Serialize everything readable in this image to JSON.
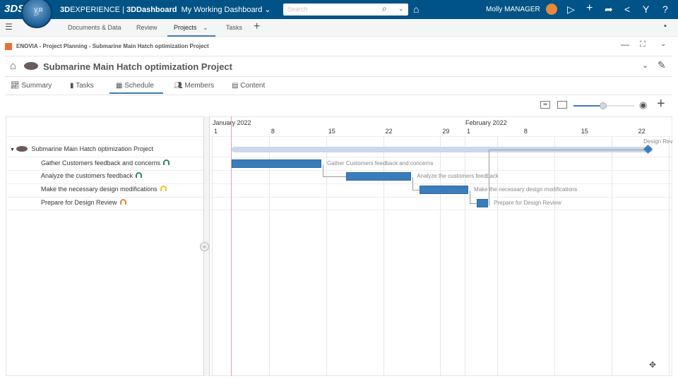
{
  "topbar": {
    "brand_bold": "3D",
    "brand_rest": "EXPERIENCE | ",
    "app": "3DDashboard",
    "dashboard": "My Working Dashboard",
    "search_placeholder": "Search",
    "user": "Molly MANAGER",
    "compass_labels": [
      "V,R",
      "3D"
    ],
    "icons": [
      "notifications-icon",
      "add-icon",
      "share-icon",
      "social-icon",
      "apps-icon",
      "help-icon"
    ]
  },
  "tabs": [
    {
      "label": "Documents & Data"
    },
    {
      "label": "Review"
    },
    {
      "label": "Projects",
      "active": true
    },
    {
      "label": "Tasks"
    }
  ],
  "widget": {
    "title": "ENOVIA - Project Planning - Submarine Main Hatch optimization Project"
  },
  "project": {
    "title": "Submarine Main Hatch optimization Project"
  },
  "subtabs": [
    {
      "label": "Summary",
      "icon": "chart-icon"
    },
    {
      "label": "Tasks",
      "icon": "clipboard-icon"
    },
    {
      "label": "Schedule",
      "icon": "calendar-icon",
      "active": true
    },
    {
      "label": "Members",
      "icon": "members-icon"
    },
    {
      "label": "Content",
      "icon": "document-icon"
    }
  ],
  "toolbar": {
    "zoom_level": 0.5
  },
  "colors": {
    "topbar": "#005386",
    "accent": "#3d7cb6",
    "bar": "#3b7cbb",
    "summary_bar": "#c9d8ec",
    "status_green": "#2e8b6a",
    "status_yellow": "#f2c230",
    "status_orange": "#e8883a"
  },
  "tree": {
    "root": "Submarine Main Hatch optimization Project",
    "tasks": [
      {
        "name": "Gather Customers feedback and concerns",
        "status": "green"
      },
      {
        "name": "Analyze the customers feedback",
        "status": "green"
      },
      {
        "name": "Make the necessary design modifications",
        "status": "yellow"
      },
      {
        "name": "Prepare for Design Review",
        "status": "orange"
      }
    ]
  },
  "gantt": {
    "months": [
      {
        "label": "January 2022",
        "start": "2022-01-01"
      },
      {
        "label": "February 2022",
        "start": "2022-02-01"
      }
    ],
    "day_ticks": [
      {
        "label": "1",
        "date": "2022-01-01"
      },
      {
        "label": "8",
        "date": "2022-01-08"
      },
      {
        "label": "15",
        "date": "2022-01-15"
      },
      {
        "label": "22",
        "date": "2022-01-22"
      },
      {
        "label": "29",
        "date": "2022-01-29"
      },
      {
        "label": "1",
        "date": "2022-02-01"
      },
      {
        "label": "8",
        "date": "2022-02-08"
      },
      {
        "label": "15",
        "date": "2022-02-15"
      },
      {
        "label": "22",
        "date": "2022-02-22"
      }
    ],
    "today": "2022-01-02",
    "summary": {
      "start": "2022-01-03",
      "end": "2022-02-24"
    },
    "tasks": [
      {
        "label": "Gather Customers feedback and concerns",
        "start": "2022-01-03",
        "end": "2022-01-14"
      },
      {
        "label": "Analyze the customers feedback",
        "start": "2022-01-17",
        "end": "2022-01-25"
      },
      {
        "label": "Make the necessary design modifications",
        "start": "2022-01-26",
        "end": "2022-02-01"
      },
      {
        "label": "Prepare for Design Review",
        "start": "2022-02-02",
        "end": "2022-02-03"
      }
    ],
    "milestone": {
      "label": "Design Review",
      "date": "2022-02-23"
    }
  }
}
